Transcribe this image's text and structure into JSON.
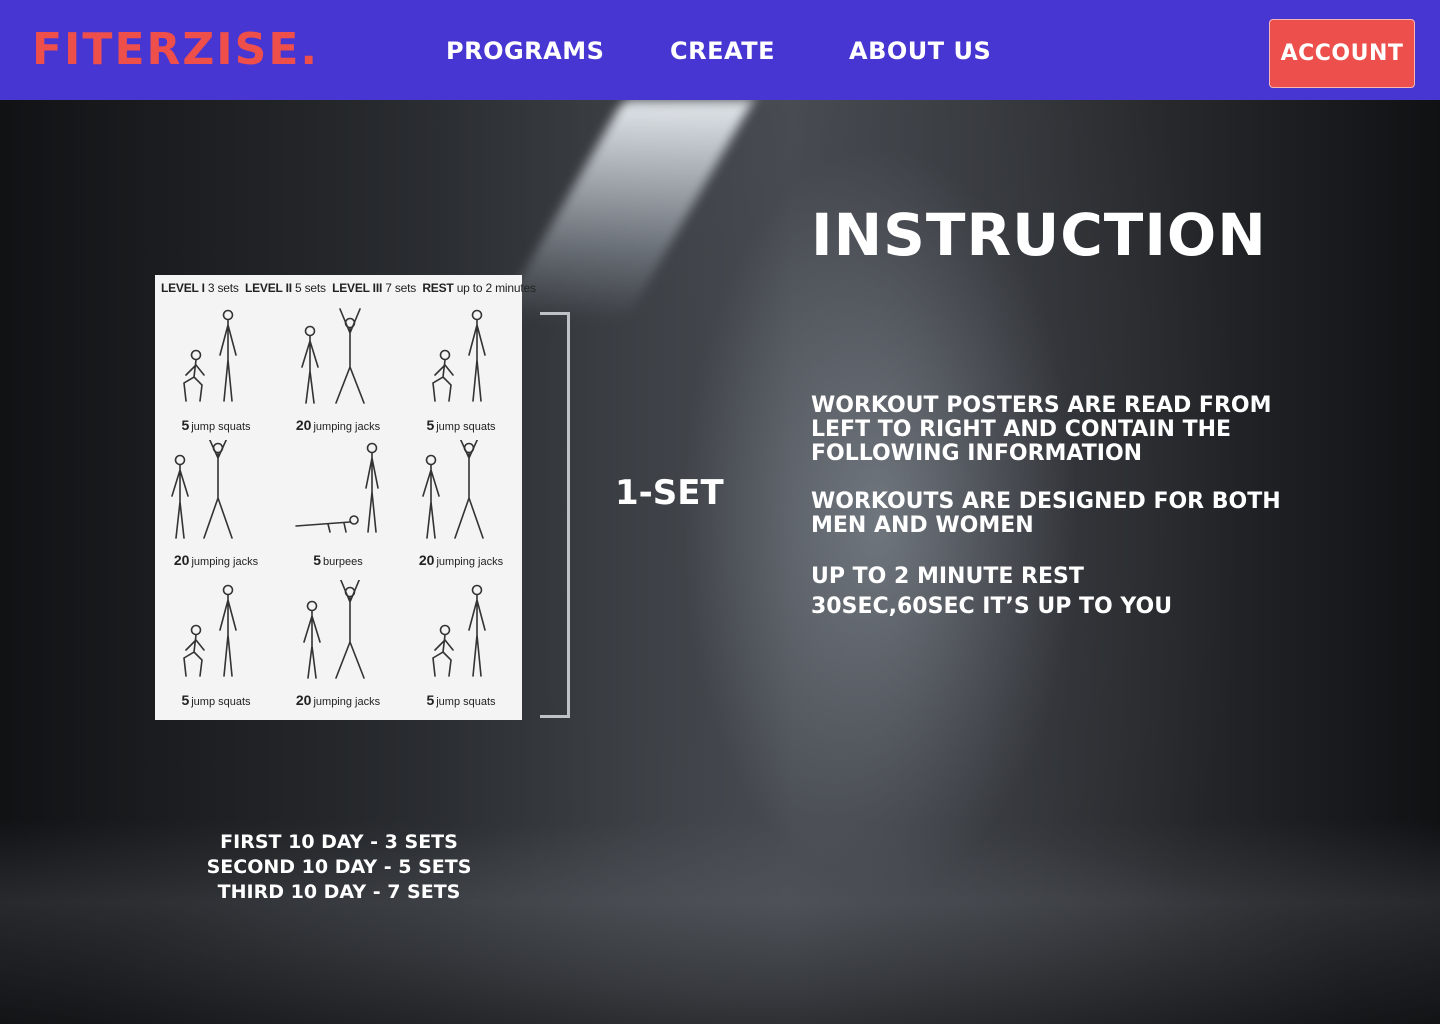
{
  "brand": {
    "logo": "FITERZISE.",
    "logo_color": "#ee4f4b",
    "bar_color": "#4836d2"
  },
  "nav": {
    "items": [
      {
        "label": "PROGRAMS"
      },
      {
        "label": "CREATE"
      },
      {
        "label": "ABOUT US"
      }
    ],
    "account_label": "ACCOUNT",
    "account_color": "#ec4f4c"
  },
  "poster": {
    "header": {
      "level1": "LEVEL I",
      "level1_sets": "3 sets",
      "level2": "LEVEL II",
      "level2_sets": "5 sets",
      "level3": "LEVEL III",
      "level3_sets": "7 sets",
      "rest": "REST",
      "rest_value": "up to 2 minutes"
    },
    "cells": [
      {
        "count": "5",
        "exercise": "jump squats",
        "icon": "jump-squat-figure-icon"
      },
      {
        "count": "20",
        "exercise": "jumping jacks",
        "icon": "jumping-jack-figure-icon"
      },
      {
        "count": "5",
        "exercise": "jump squats",
        "icon": "jump-squat-figure-icon"
      },
      {
        "count": "20",
        "exercise": "jumping jacks",
        "icon": "jumping-jack-figure-icon"
      },
      {
        "count": "5",
        "exercise": "burpees",
        "icon": "burpee-figure-icon"
      },
      {
        "count": "20",
        "exercise": "jumping jacks",
        "icon": "jumping-jack-figure-icon"
      },
      {
        "count": "5",
        "exercise": "jump squats",
        "icon": "jump-squat-figure-icon"
      },
      {
        "count": "20",
        "exercise": "jumping jacks",
        "icon": "jumping-jack-figure-icon"
      },
      {
        "count": "5",
        "exercise": "jump squats",
        "icon": "jump-squat-figure-icon"
      }
    ]
  },
  "set_label": "1-SET",
  "sets_schedule": [
    "FIRST 10 DAY - 3 SETS",
    "SECOND 10 DAY - 5 SETS",
    "THIRD 10 DAY - 7 SETS"
  ],
  "instruction": {
    "title": "INSTRUCTION",
    "p1": "WORKOUT POSTERS ARE READ FROM LEFT TO RIGHT AND CONTAIN THE FOLLOWING INFORMATION",
    "p2": "WORKOUTS ARE DESIGNED FOR BOTH MEN AND WOMEN",
    "p3_line1": "UP TO 2 MINUTE REST",
    "p3_line2": "30SEC,60SEC IT’S UP TO YOU"
  }
}
